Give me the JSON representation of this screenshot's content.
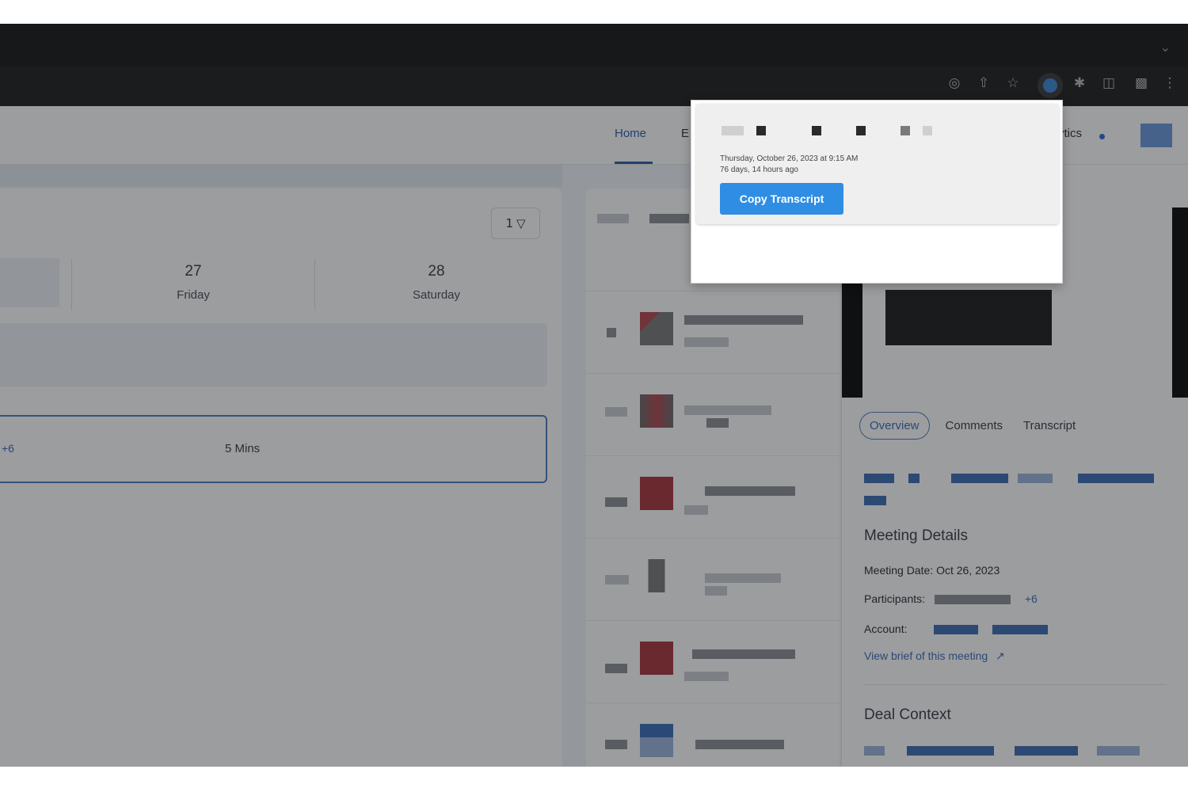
{
  "browser": {
    "icons": [
      "google-lens-icon",
      "share-icon",
      "star-icon",
      "extension-active-icon",
      "puzzle-icon",
      "sidebar-icon",
      "profile-icon",
      "more-icon"
    ]
  },
  "header": {
    "nav_home": "Home",
    "nav_partial_left": "E",
    "nav_partial_right": "ytics"
  },
  "calendar": {
    "filter_count": "1",
    "days": [
      {
        "num": "27",
        "name": "Friday"
      },
      {
        "num": "28",
        "name": "Saturday"
      }
    ],
    "meeting": {
      "participants_more": "+6",
      "duration": "5 Mins"
    }
  },
  "detail": {
    "tabs": [
      "Overview",
      "Comments",
      "Transcript"
    ],
    "meeting_details_title": "Meeting Details",
    "meeting_date_label": "Meeting Date:",
    "meeting_date_value": "Oct 26, 2023",
    "participants_label": "Participants:",
    "participants_more": "+6",
    "account_label": "Account:",
    "view_brief_link": "View brief of this meeting",
    "deal_context_title": "Deal Context"
  },
  "popup": {
    "date_line": "Thursday, October 26, 2023 at 9:15 AM",
    "ago_line": "76 days, 14 hours ago",
    "copy_button": "Copy Transcript"
  },
  "colors": {
    "accent": "#2f5fa8",
    "button": "#2f8de4",
    "chrome": "#1a1a1a"
  }
}
